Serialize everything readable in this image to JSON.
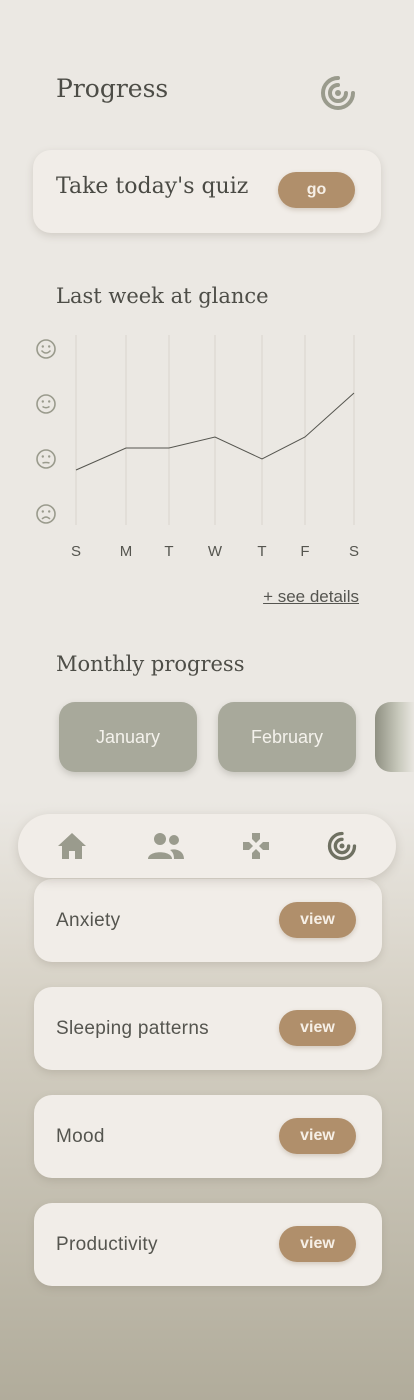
{
  "header": {
    "title": "Progress",
    "icon": "radar-icon"
  },
  "quiz": {
    "title": "Take today's quiz",
    "button": "go"
  },
  "weekly": {
    "title": "Last week at glance",
    "link": "+ see details"
  },
  "chart_data": {
    "type": "line",
    "categories": [
      "S",
      "M",
      "T",
      "W",
      "T",
      "F",
      "S"
    ],
    "values": [
      1.8,
      2.2,
      2.2,
      2.4,
      2.0,
      2.4,
      3.2
    ],
    "ylim": [
      1,
      4
    ],
    "y_tick_icons": [
      "happy-face",
      "smile-face",
      "neutral-face",
      "sad-face"
    ],
    "grid": "vertical",
    "line_color": "#55554f"
  },
  "monthly": {
    "title": "Monthly progress",
    "months": [
      "January",
      "February"
    ]
  },
  "nav": {
    "items": [
      {
        "icon": "home-icon"
      },
      {
        "icon": "people-icon"
      },
      {
        "icon": "gamepad-icon"
      },
      {
        "icon": "radar-icon",
        "active": true
      }
    ]
  },
  "items": [
    {
      "label": "Anxiety",
      "button": "view"
    },
    {
      "label": "Sleeping patterns",
      "button": "view"
    },
    {
      "label": "Mood",
      "button": "view"
    },
    {
      "label": "Productivity",
      "button": "view"
    }
  ],
  "colors": {
    "accent": "#b08f6b",
    "month_button": "#a8a99b",
    "icon": "#9a9b8d",
    "icon_active": "#6f7162"
  }
}
